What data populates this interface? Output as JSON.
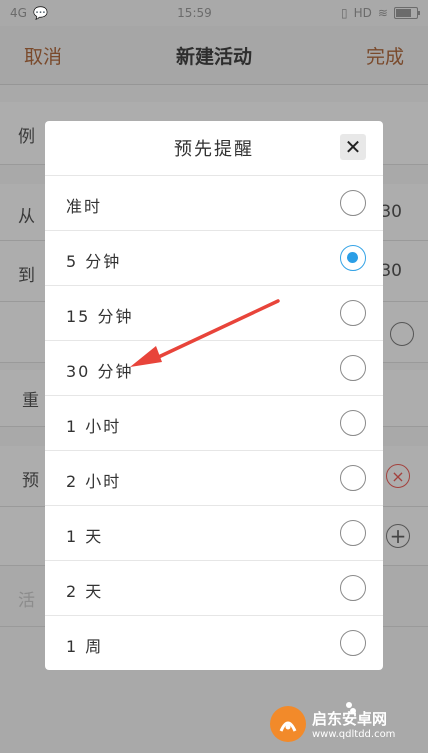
{
  "status_bar": {
    "network": "4G",
    "time": "15:59",
    "hd": "HD"
  },
  "header": {
    "cancel_label": "取消",
    "title": "新建活动",
    "done_label": "完成"
  },
  "background_rows": {
    "example_label": "例",
    "from_label": "从",
    "from_value": "30",
    "to_label": "到",
    "to_value": "30",
    "repeat_label": "重",
    "remind_label": "预",
    "activity_label": "活"
  },
  "modal": {
    "title": "预先提醒",
    "options": [
      {
        "label": "准时",
        "selected": false
      },
      {
        "label": "5 分钟",
        "selected": true
      },
      {
        "label": "15 分钟",
        "selected": false
      },
      {
        "label": "30 分钟",
        "selected": false
      },
      {
        "label": "1 小时",
        "selected": false
      },
      {
        "label": "2 小时",
        "selected": false
      },
      {
        "label": "1 天",
        "selected": false
      },
      {
        "label": "2 天",
        "selected": false
      },
      {
        "label": "1 周",
        "selected": false
      }
    ]
  },
  "watermark": {
    "name": "启东安卓网",
    "url": "www.qdltdd.com"
  },
  "colors": {
    "accent": "#2b9ee6",
    "arrow": "#e8443a",
    "header_action": "#7a4a2c"
  }
}
